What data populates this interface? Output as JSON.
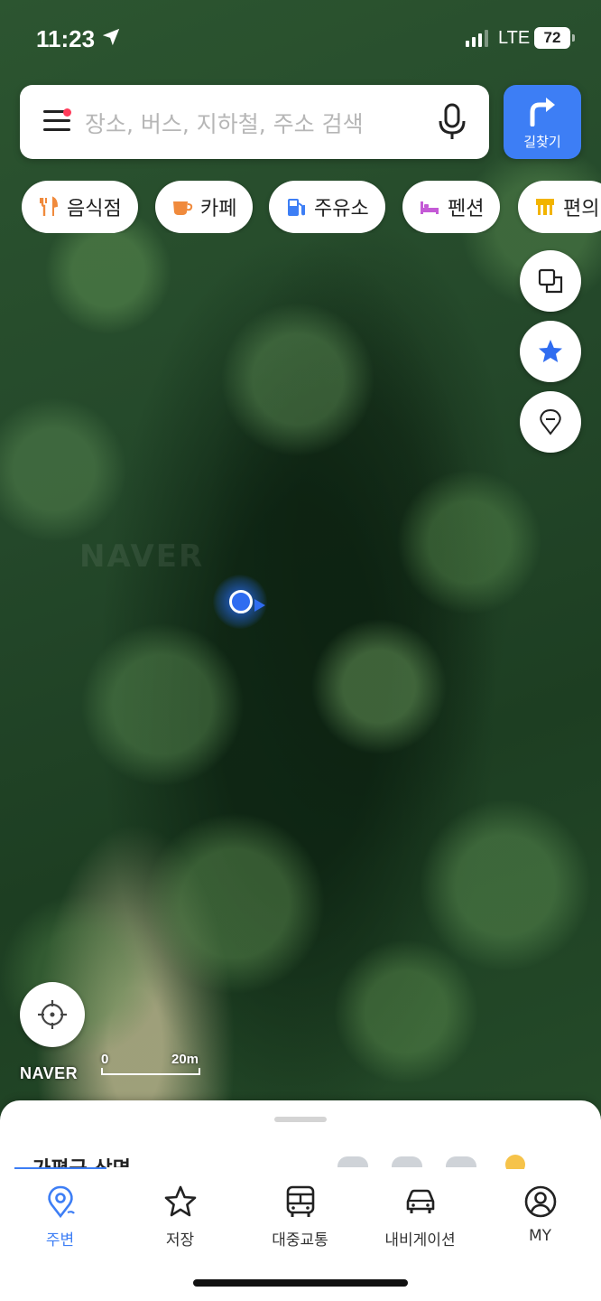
{
  "status_bar": {
    "time": "11:23",
    "network": "LTE",
    "battery": "72"
  },
  "search": {
    "placeholder": "장소, 버스, 지하철, 주소 검색"
  },
  "route_button": {
    "label": "길찾기"
  },
  "categories": [
    {
      "label": "음식점",
      "icon": "fork-knife-icon",
      "color": "#f08a3c"
    },
    {
      "label": "카페",
      "icon": "coffee-cup-icon",
      "color": "#f08a3c"
    },
    {
      "label": "주유소",
      "icon": "gas-pump-icon",
      "color": "#3d7ef5"
    },
    {
      "label": "펜션",
      "icon": "bed-icon",
      "color": "#c45ad6"
    },
    {
      "label": "편의",
      "icon": "store-icon",
      "color": "#f2b400"
    }
  ],
  "map": {
    "watermark": "NAVER",
    "logo": "NAVER",
    "scale_start": "0",
    "scale_end": "20m"
  },
  "sheet": {
    "title": "가평군 상면"
  },
  "tabs": [
    {
      "label": "주변",
      "icon": "map-pin-icon",
      "active": true
    },
    {
      "label": "저장",
      "icon": "star-outline-icon",
      "active": false
    },
    {
      "label": "대중교통",
      "icon": "bus-icon",
      "active": false
    },
    {
      "label": "내비게이션",
      "icon": "car-icon",
      "active": false
    },
    {
      "label": "MY",
      "icon": "profile-icon",
      "active": false
    }
  ],
  "colors": {
    "accent": "#3d7ef5",
    "location_dot": "#2f6cf0"
  }
}
